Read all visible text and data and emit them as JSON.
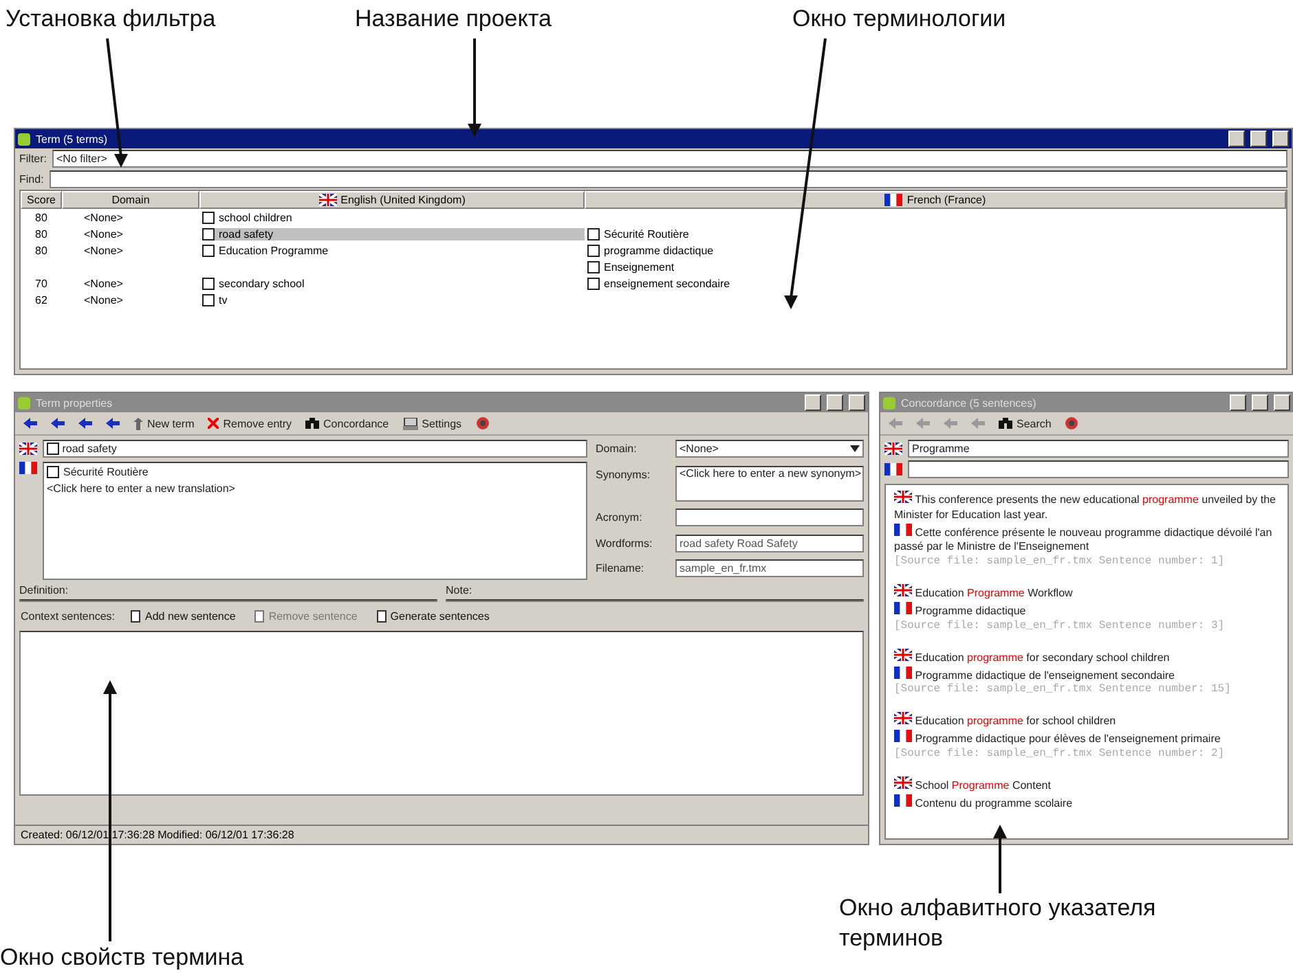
{
  "annotations": {
    "top": [
      "Установка фильтра",
      "Название проекта",
      "Окно терминологии"
    ],
    "bottom_left": "Окно свойств термина",
    "bottom_right": "Окно алфавитного указателя терминов"
  },
  "term_window": {
    "title": "Term (5 terms)",
    "active": true,
    "filter_label": "Filter:",
    "filter_value": "<No filter>",
    "find_label": "Find:",
    "columns": [
      "Score",
      "Domain",
      "English (United Kingdom)",
      "French (France)"
    ],
    "rows": [
      {
        "score": "80",
        "domain": "<None>",
        "en": "school children",
        "fr": [],
        "selected": false
      },
      {
        "score": "80",
        "domain": "<None>",
        "en": "road safety",
        "fr": [
          "Sécurité Routière"
        ],
        "selected": true
      },
      {
        "score": "80",
        "domain": "<None>",
        "en": "Education Programme",
        "fr": [
          "programme didactique",
          "Enseignement"
        ],
        "selected": false
      },
      {
        "score": "70",
        "domain": "<None>",
        "en": "secondary school",
        "fr": [
          "enseignement secondaire"
        ],
        "selected": false
      },
      {
        "score": "62",
        "domain": "<None>",
        "en": "tv",
        "fr": [],
        "selected": false
      }
    ]
  },
  "properties_window": {
    "title": "Term properties",
    "active": false,
    "toolbar": [
      {
        "kind": "nav",
        "disabled": false
      },
      {
        "kind": "nav",
        "disabled": false
      },
      {
        "kind": "nav",
        "disabled": false
      },
      {
        "kind": "nav",
        "disabled": false
      },
      {
        "kind": "new",
        "label": "New term"
      },
      {
        "kind": "remove",
        "label": "Remove entry"
      },
      {
        "kind": "concordance",
        "label": "Concordance"
      },
      {
        "kind": "settings",
        "label": "Settings"
      },
      {
        "kind": "help"
      }
    ],
    "en_term": "road safety",
    "fr_terms": [
      "Sécurité Routière"
    ],
    "fr_hint": "<Click here to enter a new translation>",
    "fields": [
      {
        "label": "Domain:",
        "value": "<None>",
        "kind": "dropdown"
      },
      {
        "label": "Synonyms:",
        "value": "<Click here to enter a new synonym>",
        "kind": "area"
      },
      {
        "label": "Acronym:",
        "kind": "text"
      },
      {
        "label": "Wordforms:",
        "value": "road safety Road Safety",
        "kind": "text"
      },
      {
        "label": "Filename:",
        "value": "sample_en_fr.tmx",
        "kind": "text"
      }
    ],
    "definition_label": "Definition:",
    "note_label": "Note:",
    "context_label": "Context sentences:",
    "context_buttons": [
      {
        "label": "Add new sentence",
        "disabled": false
      },
      {
        "label": "Remove sentence",
        "disabled": true
      },
      {
        "label": "Generate sentences",
        "disabled": false
      }
    ],
    "status": "Created: 06/12/01 17:36:28   Modified: 06/12/01 17:36:28"
  },
  "concordance_window": {
    "title": "Concordance (5 sentences)",
    "active": false,
    "toolbar": [
      {
        "kind": "nav",
        "disabled": true
      },
      {
        "kind": "nav",
        "disabled": true
      },
      {
        "kind": "nav",
        "disabled": true
      },
      {
        "kind": "nav",
        "disabled": true
      },
      {
        "kind": "search",
        "label": "Search"
      },
      {
        "kind": "help"
      }
    ],
    "en_query": "Programme",
    "entries": [
      {
        "en": {
          "before": "This conference presents the new educational ",
          "match": "programme",
          "after": " unveiled by the Minister for Education last year."
        },
        "fr": "Cette conférence présente le nouveau programme didactique dévoilé l'an passé par le Ministre de l'Enseignement",
        "source": "[Source file: sample_en_fr.tmx Sentence number: 1]"
      },
      {
        "en": {
          "before": "Education ",
          "match": "Programme",
          "after": " Workflow"
        },
        "fr": "Programme didactique",
        "source": "[Source file: sample_en_fr.tmx Sentence number: 3]"
      },
      {
        "en": {
          "before": "Education ",
          "match": "programme",
          "after": " for secondary school children"
        },
        "fr": "Programme didactique de l'enseignement secondaire",
        "source": "[Source file: sample_en_fr.tmx Sentence number: 15]"
      },
      {
        "en": {
          "before": "Education ",
          "match": "programme",
          "after": " for school children"
        },
        "fr": "Programme didactique pour élèves de l'enseignement primaire",
        "source": "[Source file: sample_en_fr.tmx Sentence number: 2]"
      },
      {
        "en": {
          "before": "School ",
          "match": "Programme",
          "after": " Content"
        },
        "fr": "Contenu du programme scolaire"
      }
    ]
  }
}
